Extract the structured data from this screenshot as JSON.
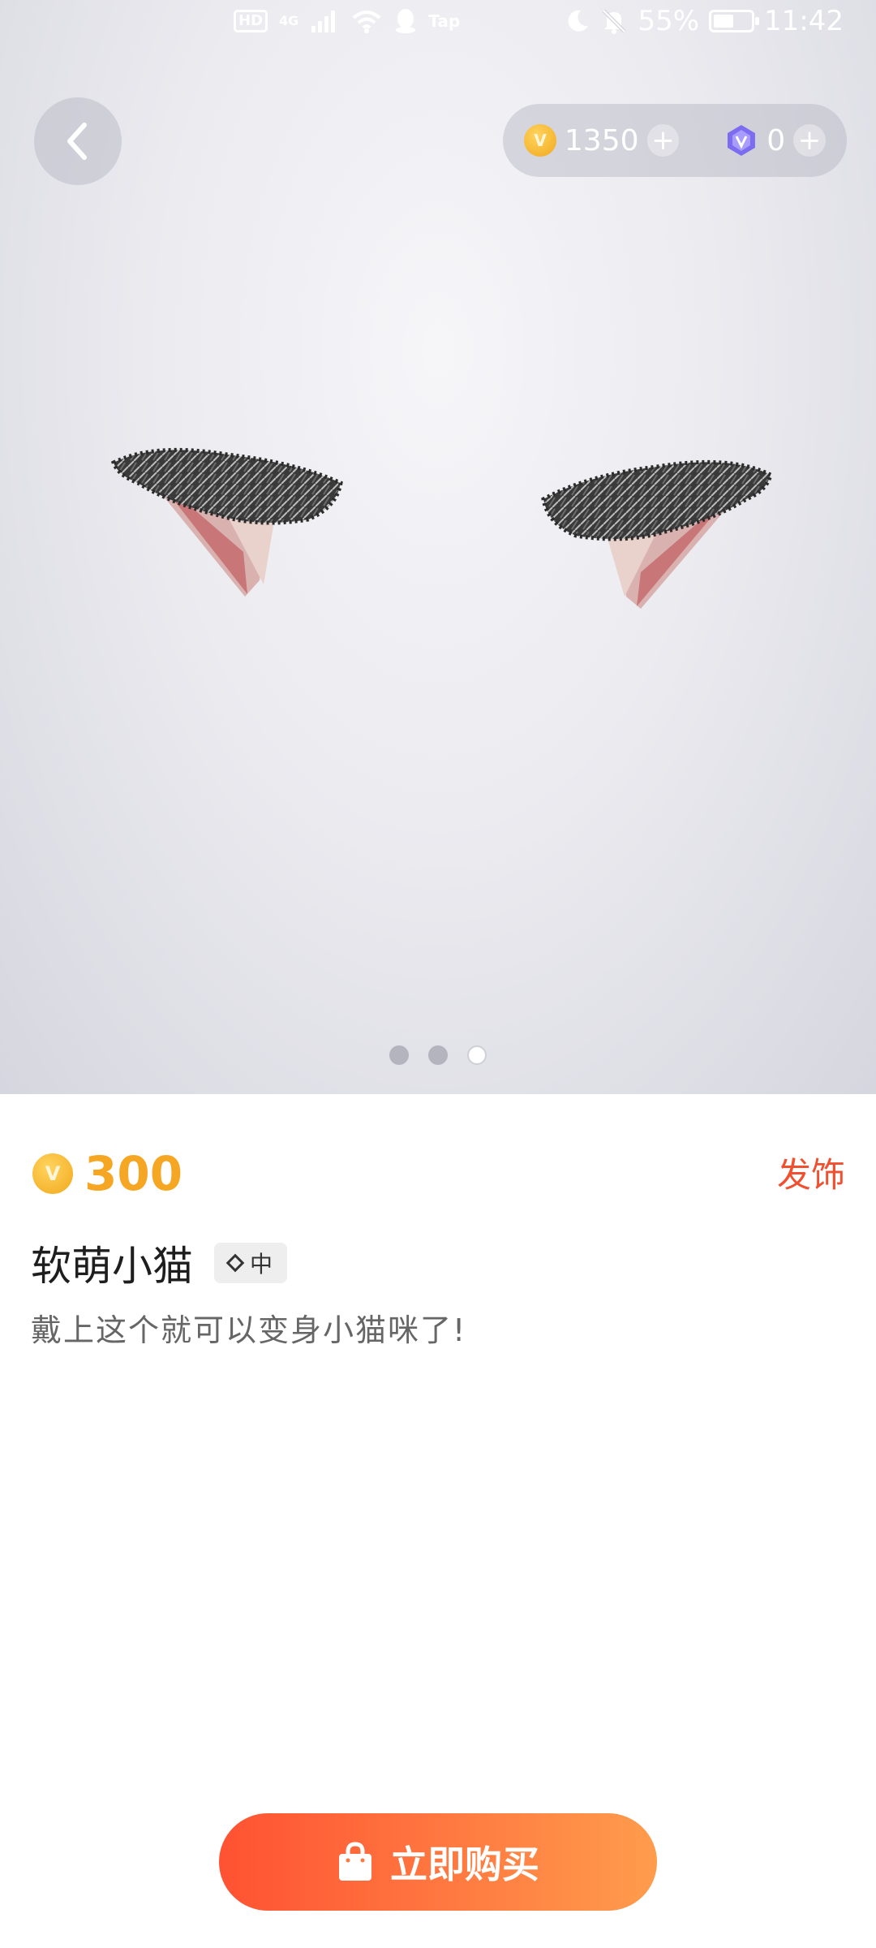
{
  "status_bar": {
    "hd": "HD",
    "network": "4G",
    "tap": "Tap",
    "battery": "55%",
    "battery_level": 0.55,
    "time": "11:42"
  },
  "wallet": {
    "coins": "1350",
    "gems": "0"
  },
  "gallery": {
    "page_count": 3,
    "active_index": 2
  },
  "item": {
    "price": "300",
    "category": "发饰",
    "title": "软萌小猫",
    "tag": "中",
    "description": "戴上这个就可以变身小猫咪了!"
  },
  "actions": {
    "buy_label": "立即购买"
  },
  "colors": {
    "price": "#f5a623",
    "category": "#f0502f",
    "buy_gradient_start": "#ff5233",
    "buy_gradient_end": "#ff9c4c"
  }
}
